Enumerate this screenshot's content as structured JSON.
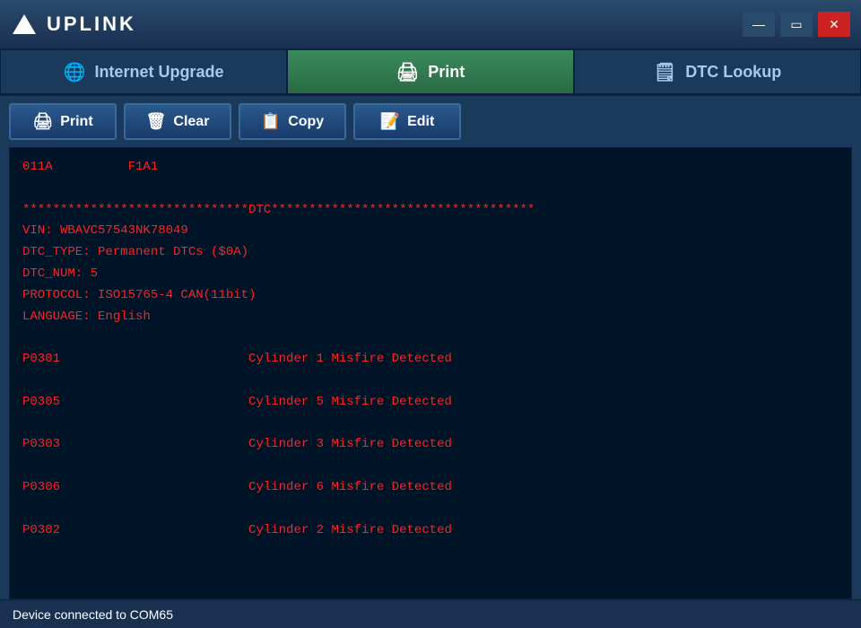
{
  "app": {
    "title": "UPLINK",
    "logo_unicode": "▲"
  },
  "window_controls": {
    "minimize_label": "—",
    "restore_label": "▭",
    "close_label": "✕"
  },
  "nav": {
    "tabs": [
      {
        "id": "internet-upgrade",
        "label": "Internet Upgrade",
        "icon": "🌐",
        "active": false
      },
      {
        "id": "print",
        "label": "Print",
        "icon": "🖨",
        "active": true
      },
      {
        "id": "dtc-lookup",
        "label": "DTC Lookup",
        "icon": "🗒",
        "active": false
      }
    ]
  },
  "actions": [
    {
      "id": "print",
      "label": "Print",
      "icon": "🖨"
    },
    {
      "id": "clear",
      "label": "Clear",
      "icon": "🗑"
    },
    {
      "id": "copy",
      "label": "Copy",
      "icon": "📋"
    },
    {
      "id": "edit",
      "label": "Edit",
      "icon": "📝"
    }
  ],
  "content": {
    "text_lines": [
      "011A          F1A1",
      "",
      "******************************DTC***********************************",
      "VIN: WBAVC57543NK78049",
      "DTC_TYPE: Permanent DTCs ($0A)",
      "DTC_NUM: 5",
      "PROTOCOL: ISO15765-4 CAN(11bit)",
      "LANGUAGE: English",
      "",
      "P0301                         Cylinder 1 Misfire Detected",
      "",
      "P0305                         Cylinder 5 Misfire Detected",
      "",
      "P0303                         Cylinder 3 Misfire Detected",
      "",
      "P0306                         Cylinder 6 Misfire Detected",
      "",
      "P0302                         Cylinder 2 Misfire Detected"
    ]
  },
  "status_bar": {
    "text": "Device connected to COM65"
  }
}
